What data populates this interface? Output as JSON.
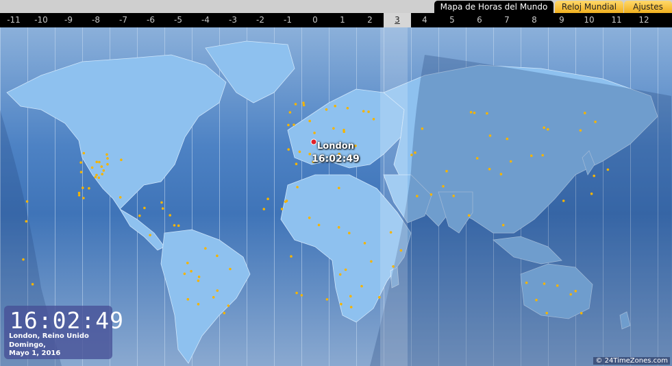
{
  "tabs": {
    "map": "Mapa de Horas del Mundo",
    "clock": "Reloj Mundial",
    "settings": "Ajustes"
  },
  "timezones": [
    "-11",
    "-10",
    "-9",
    "-8",
    "-7",
    "-6",
    "-5",
    "-4",
    "-3",
    "-2",
    "-1",
    "0",
    "1",
    "2",
    "3",
    "4",
    "5",
    "6",
    "7",
    "8",
    "9",
    "10",
    "11",
    "12"
  ],
  "active_timezone": "3",
  "location": {
    "name": "London",
    "time": "16:02:49"
  },
  "clock": {
    "time": "16:02:49",
    "city": "London, Reino Unido",
    "day": "Domingo,",
    "date": "Mayo 1, 2016"
  },
  "copyright": "© 24TimeZones.com",
  "colors": {
    "ocean": "#5a8ec8",
    "land": "#8ec1ef",
    "night_overlay": "#2f5a98",
    "city_dot": "#f5b400",
    "selected_city": "#e0202a",
    "tab_active": "#000000",
    "tab_inactive": "#f0b020"
  }
}
